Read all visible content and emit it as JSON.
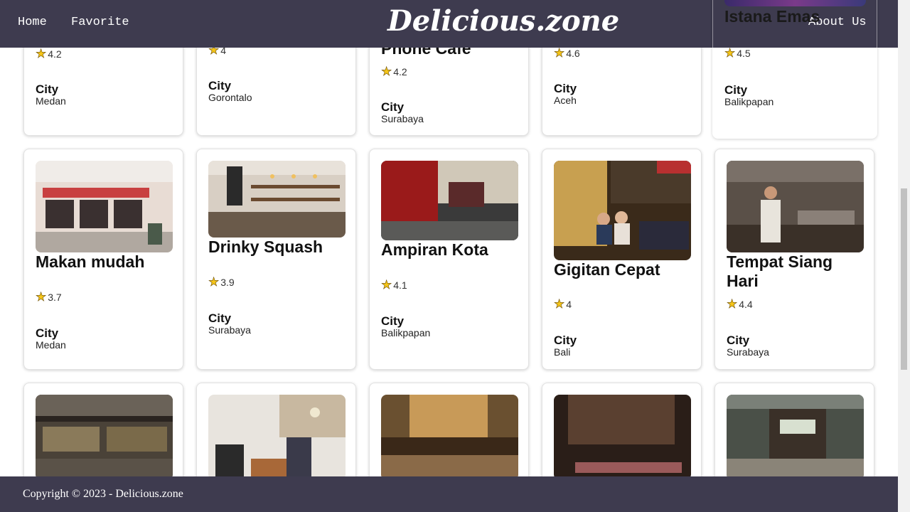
{
  "nav": {
    "home": "Home",
    "favorite": "Favorite",
    "brand": "Delicious.zone",
    "about": "About Us"
  },
  "footer": {
    "text": "Copyright © 2023 - Delicious.zone"
  },
  "city_label": "City",
  "row1": [
    {
      "title": "",
      "rating": "4.2",
      "city": "Medan"
    },
    {
      "title": "",
      "rating": "4",
      "city": "Gorontalo"
    },
    {
      "title": "Phone Cafe",
      "rating": "4.2",
      "city": "Surabaya"
    },
    {
      "title": "",
      "rating": "4.6",
      "city": "Aceh"
    },
    {
      "title": "Istana Emas",
      "rating": "4.5",
      "city": "Balikpapan"
    }
  ],
  "row2": [
    {
      "title": "Makan mudah",
      "rating": "3.7",
      "city": "Medan"
    },
    {
      "title": "Drinky Squash",
      "rating": "3.9",
      "city": "Surabaya"
    },
    {
      "title": "Ampiran Kota",
      "rating": "4.1",
      "city": "Balikpapan"
    },
    {
      "title": "Gigitan Cepat",
      "rating": "4",
      "city": "Bali"
    },
    {
      "title": "Tempat Siang Hari",
      "rating": "4.4",
      "city": "Surabaya"
    }
  ],
  "colors": {
    "header_bg": "#3e3b4f",
    "star": "#f5c518"
  },
  "icons": {
    "rating": "star-icon"
  }
}
